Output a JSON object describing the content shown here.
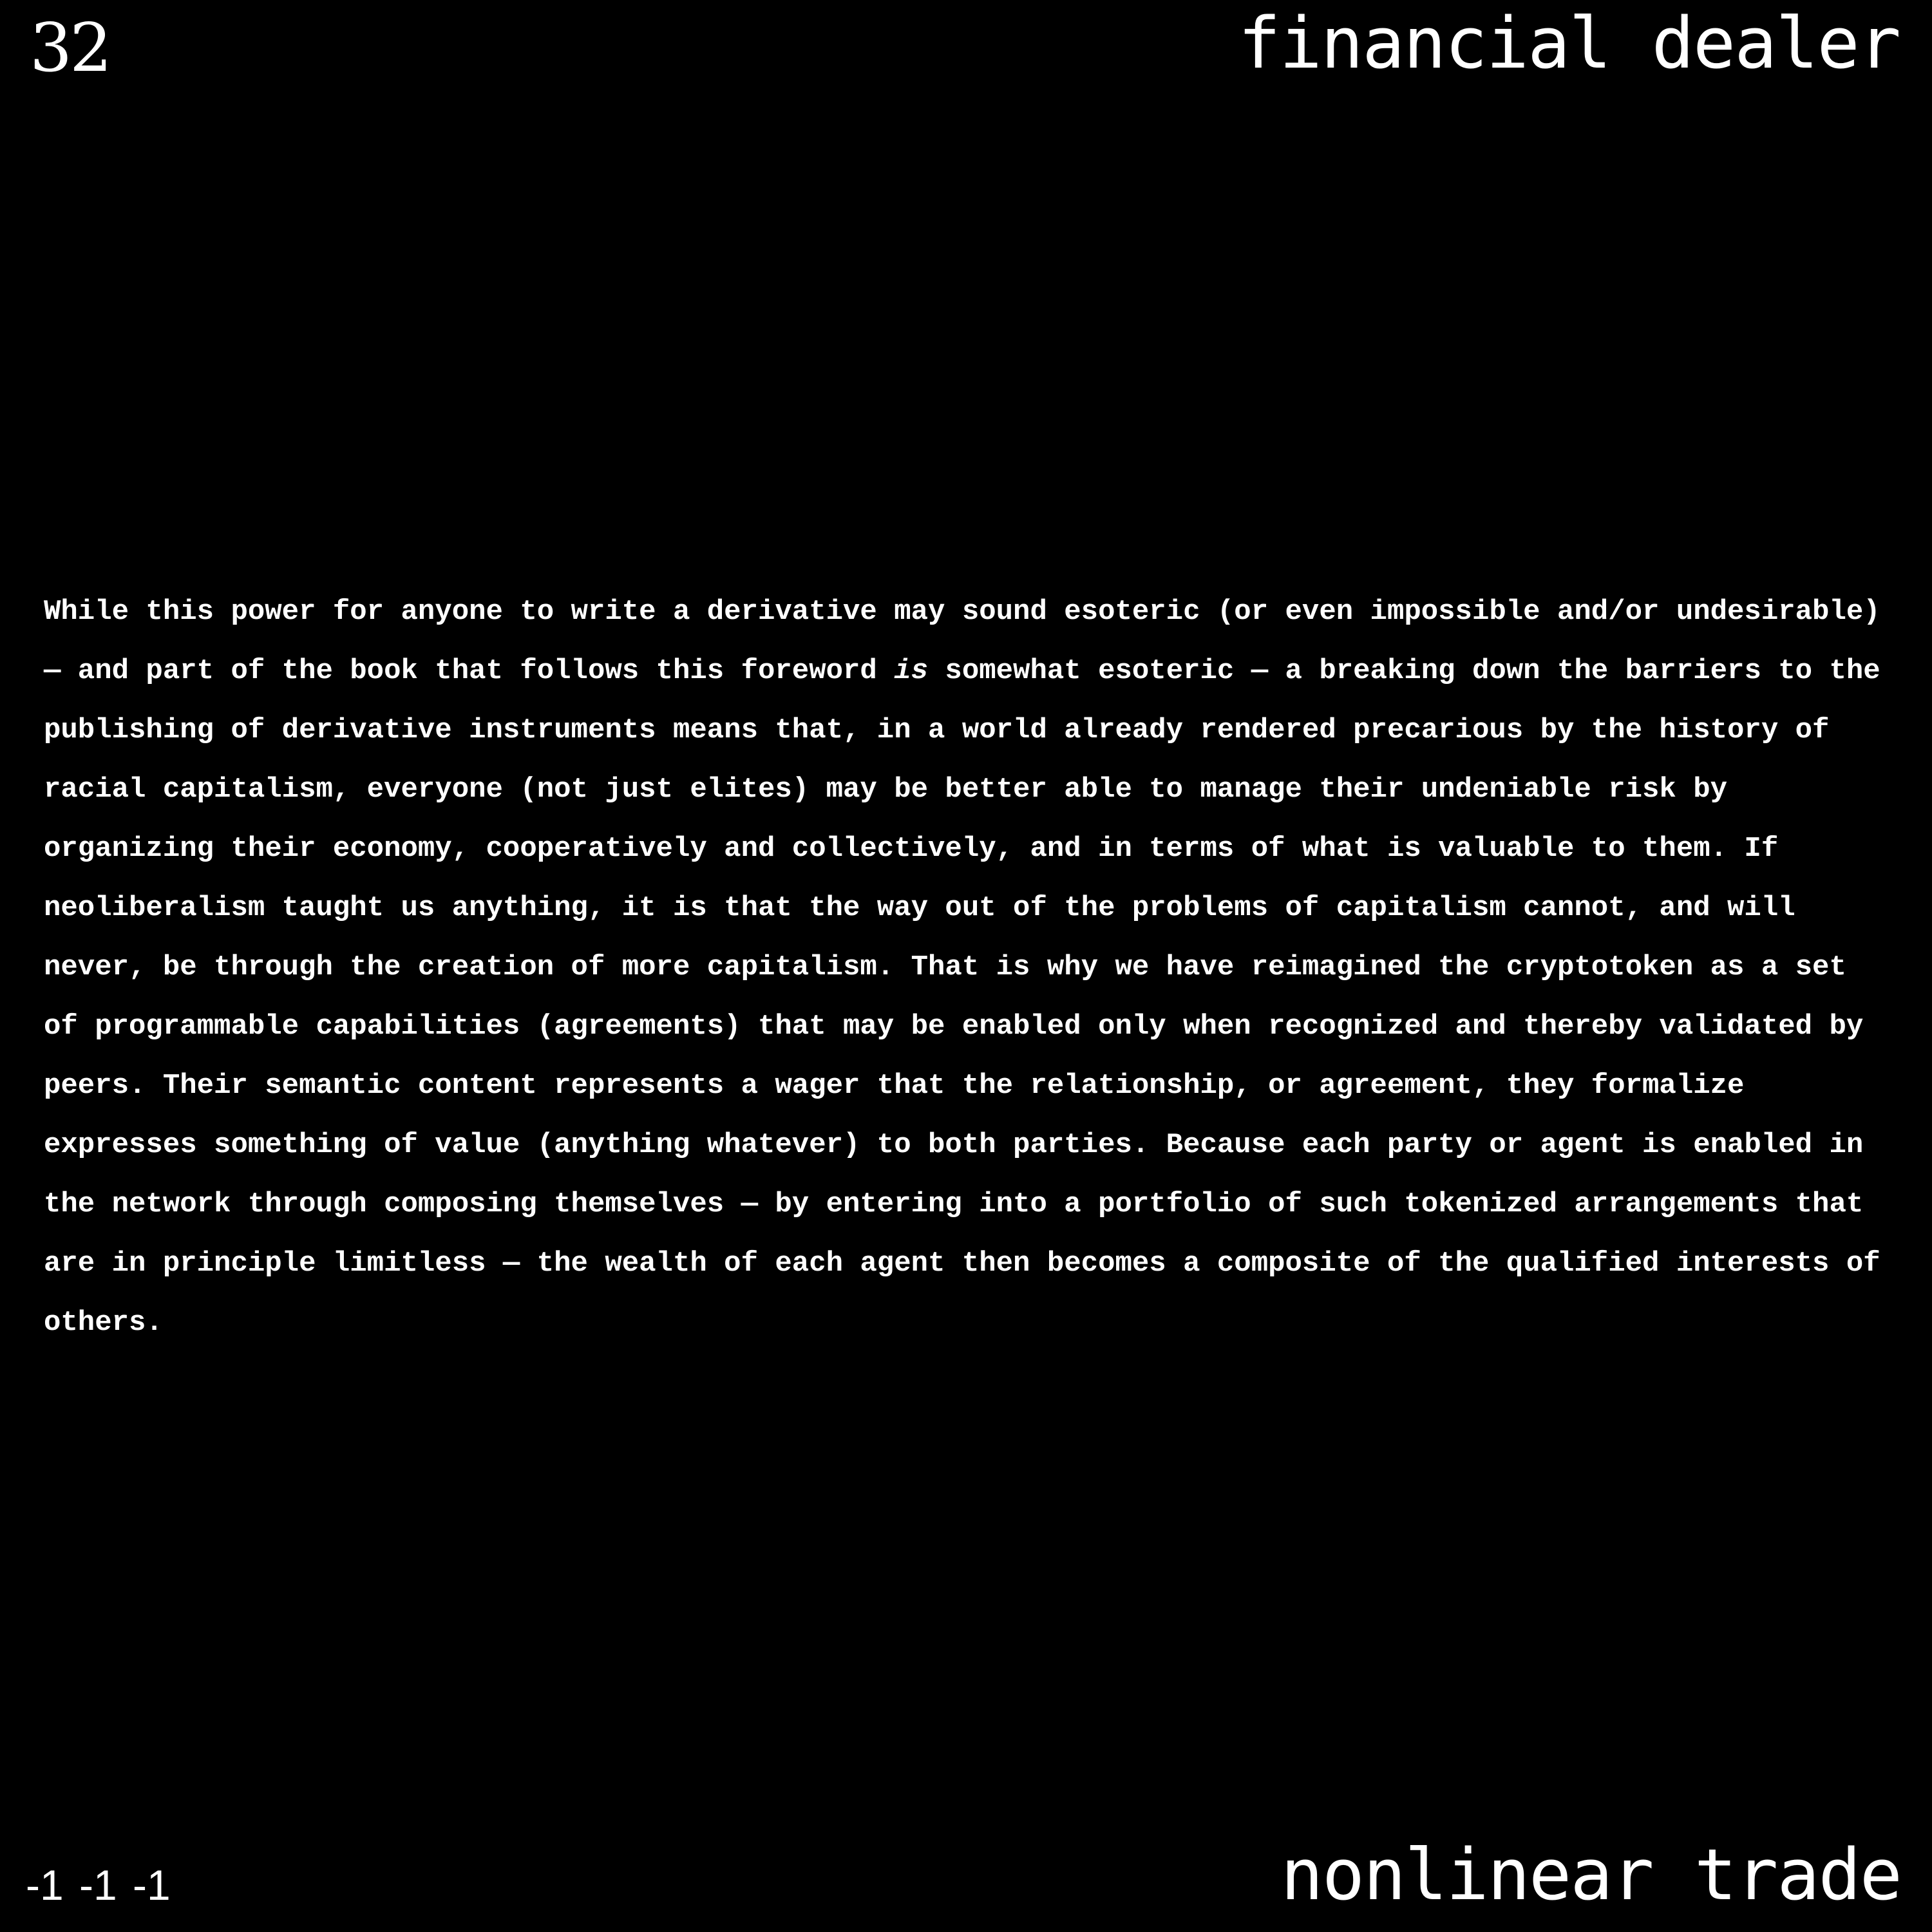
{
  "header": {
    "page_number": "32",
    "title": "financial dealer"
  },
  "body": {
    "lines": [
      {
        "text": "While this power for anyone to write a derivative may sound esoteric (or even impossible and/or undesirable)"
      },
      {
        "before": "— and part of the book that follows this foreword ",
        "emphasis": "is",
        "after": " somewhat esoteric — a breaking down the barriers to the"
      },
      {
        "text": "publishing of derivative instruments means that, in a world already rendered precarious by the history of"
      },
      {
        "text": "racial capitalism, everyone (not just elites) may be better able to manage their undeniable risk by"
      },
      {
        "text": "organizing their economy, cooperatively and collectively, and in terms of what is valuable to them. If"
      },
      {
        "text": "neoliberalism taught us anything, it is that the way out of the problems of capitalism cannot, and will"
      },
      {
        "text": "never, be through the creation of more capitalism. That is why we have reimagined the cryptotoken as a set"
      },
      {
        "text": "of programmable capabilities (agreements) that may be enabled only when recognized and thereby validated by"
      },
      {
        "text": "peers. Their semantic content represents a wager that the relationship, or agreement, they formalize"
      },
      {
        "text": "expresses something of value (anything whatever) to both parties. Because each party or agent is enabled in"
      },
      {
        "text": "the network through composing themselves — by entering into a portfolio of such tokenized arrangements that"
      },
      {
        "text": "are in principle limitless — the wealth of each agent then becomes a composite of the qualified interests of"
      },
      {
        "text": "others."
      }
    ]
  },
  "footer": {
    "code": "-1 -1 -1",
    "title": "nonlinear trade"
  },
  "colors": {
    "background": "#000000",
    "text": "#ffffff"
  }
}
